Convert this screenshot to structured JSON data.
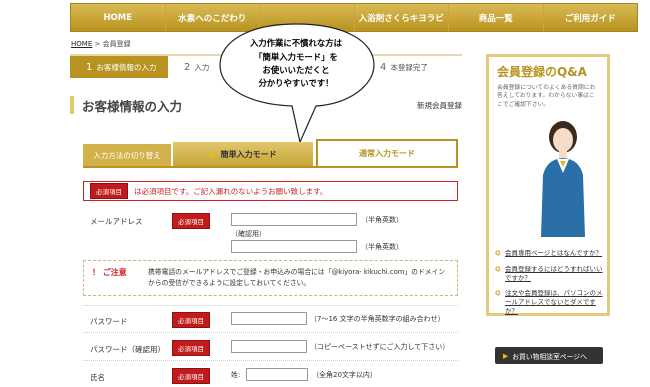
{
  "nav": {
    "items": [
      "HOME",
      "水素へのこだわり",
      "",
      "入浴剤さくらキヨラビ",
      "商品一覧",
      "ご利用ガイド"
    ]
  },
  "breadcrumb": {
    "home": "HOME",
    "separator": ">",
    "current": "会員登録"
  },
  "steps": [
    {
      "num": "1",
      "label": "お客様情報の入力"
    },
    {
      "num": "2",
      "label": "入力"
    },
    {
      "num": "3",
      "label": ""
    },
    {
      "num": "4",
      "label": "本登録完了"
    }
  ],
  "section": {
    "title": "お客様情報の入力",
    "sub": "新規会員登録"
  },
  "mode": {
    "label": "入力方法の切り替え",
    "easy": "簡単入力モード",
    "normal": "通常入力モード"
  },
  "required_note": {
    "badge": "必須項目",
    "text": "は必須項目です。ご記入漏れのないようお願い致します。"
  },
  "form": {
    "badge": "必須項目",
    "email_label": "メールアドレス",
    "email_hint": "（半角英数）",
    "email_confirm_note": "（確認用）",
    "email_confirm_hint": "（半角英数）",
    "caution_title": "ご注意",
    "caution_text_1": "携帯電話のメールアドレスでご登録・お申込みの場合には「@kiyora- kikuchi.com」のドメイン",
    "caution_text_2": "からの受信ができるように設定しておいてください。",
    "password_label": "パスワード",
    "password_hint": "（7～16 文字の半角英数字の組み合わせ）",
    "password_confirm_label": "パスワード（確認用）",
    "password_confirm_hint": "（コピーペーストせずにご入力して下さい）",
    "name_label": "氏名",
    "last_name_label": "姓:",
    "name_hint": "（全角20文字以内）"
  },
  "bubble": {
    "line1": "入力作業に不慣れな方は",
    "line2": "「簡単入力モード」を",
    "line3": "お使いいただくと",
    "line4": "分かりやすいです！"
  },
  "sidebar": {
    "title": "会員登録のQ&A",
    "desc": "会員登録についてのよくある質問にお答えしております。わからない事はここでご確認下さい。",
    "questions": [
      "会員専用ページとはなんですか？",
      "会員登録するにはどうすればいいですか？",
      "注文や会員登録は、パソコンのメールアドレスでないとダメですか？"
    ],
    "shop_button": "お買い物相談室ページへ"
  },
  "colors": {
    "gold": "#b8931f",
    "red": "#c11b1b"
  }
}
